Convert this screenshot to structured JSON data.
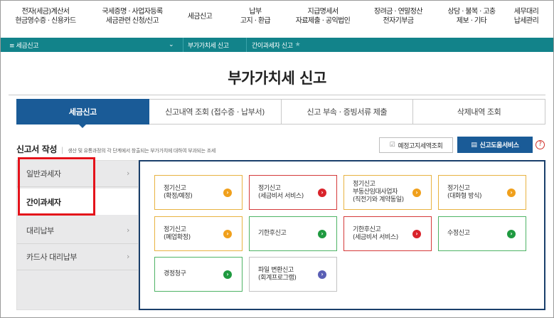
{
  "topnav": [
    {
      "l1": "전자(세금)계산서",
      "l2": "현금영수증 · 신용카드"
    },
    {
      "l1": "국세증명 · 사업자등록",
      "l2": "세금관련 신청/신고"
    },
    {
      "l1": "세금신고",
      "l2": ""
    },
    {
      "l1": "납부",
      "l2": "고지 · 환급"
    },
    {
      "l1": "지급명세서",
      "l2": "자료제출 · 공익법인"
    },
    {
      "l1": "장려금 · 연말정산",
      "l2": "전자기부금"
    },
    {
      "l1": "상담 · 불복 · 고충",
      "l2": "제보 · 기타"
    },
    {
      "l1": "세무대리",
      "l2": "납세관리"
    }
  ],
  "bar": {
    "menu": "≡ 세금신고",
    "chevron": "⌄",
    "crumb1": "부가가치세 신고",
    "crumb2": "간이과세자 신고",
    "star": "★"
  },
  "page_title": "부가가치세 신고",
  "tabs": [
    "세금신고",
    "신고내역 조회 (접수증 · 납부서)",
    "신고 부속 · 증빙서류 제출",
    "삭제내역 조회"
  ],
  "section": {
    "title": "신고서 작성",
    "sep": "|",
    "desc": "생산 및 유통과정의 각 단계에서 창출되는 부가가치에 대하여 부과되는 조세"
  },
  "buttons": {
    "notice": "예정고지세액조회",
    "notice_icon": "☑",
    "help_service": "신고도움서비스",
    "help_icon": "▤",
    "help_q": "?"
  },
  "sidebar": [
    {
      "label": "일반과세자",
      "arrow": "›"
    },
    {
      "label": "간이과세자",
      "arrow": ""
    },
    {
      "label": "대리납부",
      "arrow": "›"
    },
    {
      "label": "카드사 대리납부",
      "arrow": "›"
    }
  ],
  "cards": [
    {
      "l1": "정기신고",
      "l2": "(확정/예정)",
      "l3": "",
      "color": "orange",
      "arrow": "›"
    },
    {
      "l1": "정기신고",
      "l2": "(세금비서 서비스)",
      "l3": "",
      "color": "red",
      "arrow": "›"
    },
    {
      "l1": "정기신고",
      "l2": "부동산임대사업자",
      "l3": "(직전기와 계약동일)",
      "color": "orange",
      "arrow": "›"
    },
    {
      "l1": "정기신고",
      "l2": "(대화형 방식)",
      "l3": "",
      "color": "orange",
      "arrow": "›"
    },
    {
      "l1": "정기신고",
      "l2": "(폐업확정)",
      "l3": "",
      "color": "orange",
      "arrow": "›"
    },
    {
      "l1": "기한후신고",
      "l2": "",
      "l3": "",
      "color": "green",
      "arrow": "›"
    },
    {
      "l1": "기한후신고",
      "l2": "(세금비서 서비스)",
      "l3": "",
      "color": "red",
      "arrow": "›"
    },
    {
      "l1": "수정신고",
      "l2": "",
      "l3": "",
      "color": "green",
      "arrow": "›"
    },
    {
      "l1": "경정청구",
      "l2": "",
      "l3": "",
      "color": "green",
      "arrow": "›"
    },
    {
      "l1": "파일 변환신고",
      "l2": "(회계프로그램)",
      "l3": "",
      "color": "purple",
      "arrow": "›"
    }
  ],
  "colors": {
    "teal": "#12838a",
    "navy": "#1a5b97",
    "highlight": "#e4131b"
  }
}
